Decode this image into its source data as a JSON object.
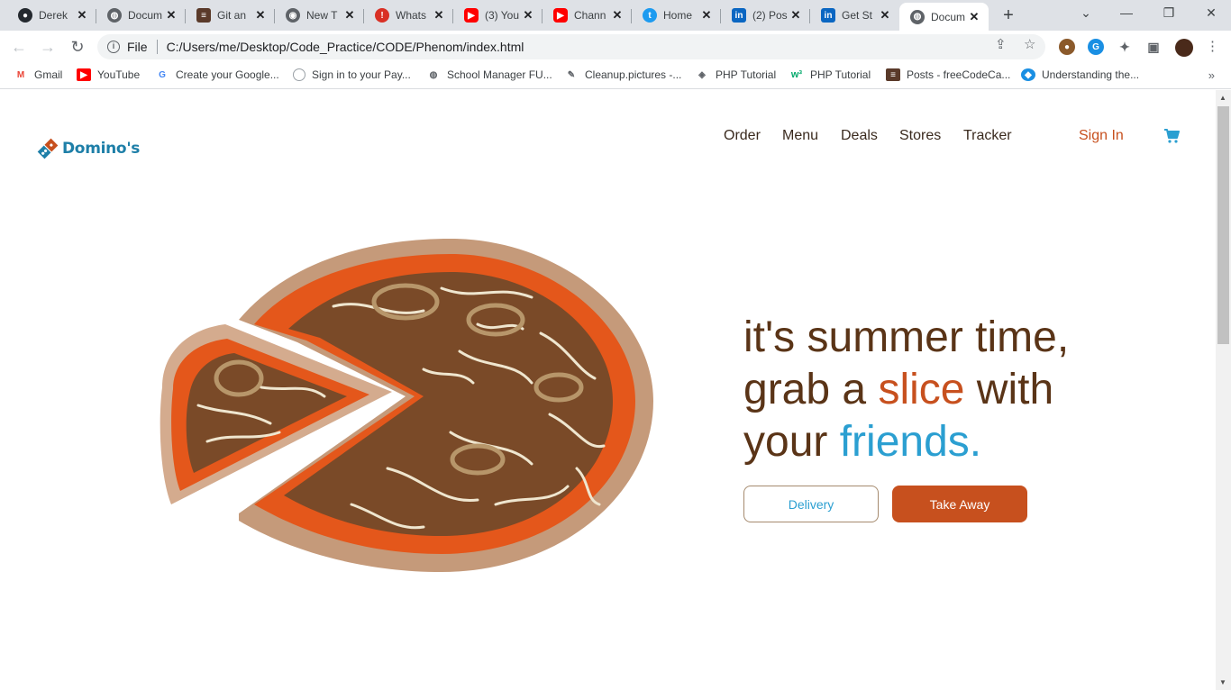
{
  "browser": {
    "tabs": [
      {
        "label": "Derek",
        "icon": "github-icon",
        "color": "#24292f"
      },
      {
        "label": "Docum",
        "icon": "globe-icon",
        "color": "#5f6368"
      },
      {
        "label": "Git an",
        "icon": "doc-icon",
        "color": "#5a3a2a"
      },
      {
        "label": "New T",
        "icon": "chrome-icon",
        "color": "#5f6368"
      },
      {
        "label": "Whats",
        "icon": "alert-icon",
        "color": "#d93025"
      },
      {
        "label": "(3) You",
        "icon": "youtube-icon",
        "color": "#ff0000"
      },
      {
        "label": "Chann",
        "icon": "youtube-icon",
        "color": "#ff0000"
      },
      {
        "label": "Home",
        "icon": "twitter-icon",
        "color": "#1d9bf0"
      },
      {
        "label": "(2) Pos",
        "icon": "linkedin-icon",
        "color": "#0a66c2"
      },
      {
        "label": "Get St",
        "icon": "linkedin-icon",
        "color": "#0a66c2"
      },
      {
        "label": "Docum",
        "icon": "globe-icon",
        "color": "#5f6368",
        "active": true
      }
    ],
    "address": {
      "scheme": "File",
      "url": "C:/Users/me/Desktop/Code_Practice/CODE/Phenom/index.html"
    },
    "bookmarks": [
      {
        "label": "Gmail",
        "icon": "gmail-icon"
      },
      {
        "label": "YouTube",
        "icon": "youtube-icon"
      },
      {
        "label": "Create your Google...",
        "icon": "google-icon"
      },
      {
        "label": "Sign in to your Pay...",
        "icon": "circle-icon"
      },
      {
        "label": "School Manager FU...",
        "icon": "globe-icon"
      },
      {
        "label": "Cleanup.pictures -...",
        "icon": "brush-icon"
      },
      {
        "label": "PHP Tutorial",
        "icon": "diamond-icon"
      },
      {
        "label": "PHP Tutorial",
        "icon": "w3-icon"
      },
      {
        "label": "Posts - freeCodeCa...",
        "icon": "fcc-icon"
      },
      {
        "label": "Understanding the...",
        "icon": "shield-icon"
      }
    ]
  },
  "site": {
    "brand": "Domino's",
    "nav": [
      "Order",
      "Menu",
      "Deals",
      "Stores",
      "Tracker"
    ],
    "sign_in": "Sign In",
    "hero": {
      "line1": "it's summer time,",
      "line2_pre": "grab a ",
      "line2_accent": "slice",
      "line2_post": " with",
      "line3_pre": "your ",
      "line3_accent": "friends."
    },
    "buttons": {
      "delivery": "Delivery",
      "take_away": "Take Away"
    },
    "colors": {
      "brown": "#5a3417",
      "orange": "#c7501e",
      "blue": "#2b9fd1"
    }
  }
}
